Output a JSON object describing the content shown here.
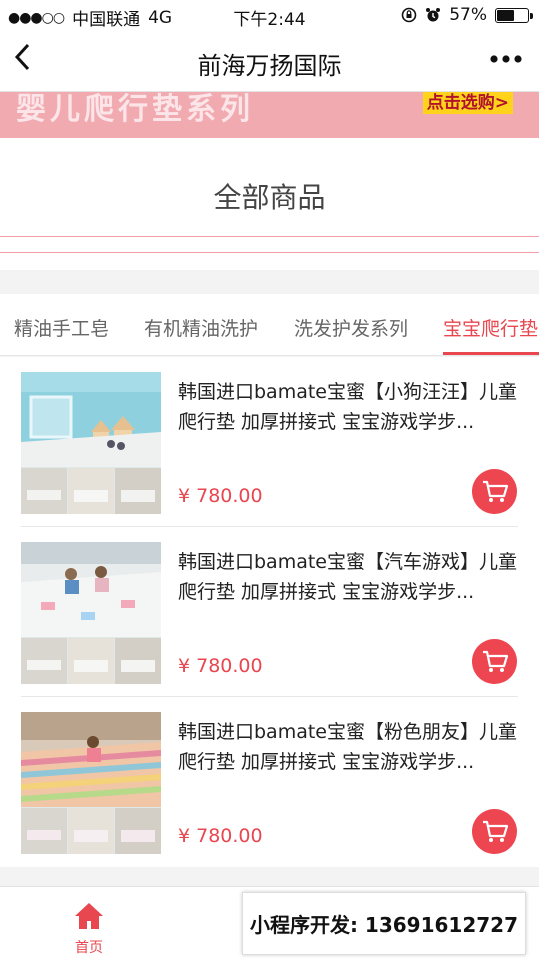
{
  "status_bar": {
    "signal": "●●●○○",
    "carrier": "中国联通",
    "network": "4G",
    "time": "下午2:44",
    "battery": "57%",
    "battery_level": 0.57
  },
  "nav": {
    "back_icon": "chevron-left-icon",
    "title": "前海万扬国际",
    "more_icon": "more-dots-icon"
  },
  "banner": {
    "text": "婴儿爬行垫系列",
    "button": "点击选购>"
  },
  "section": {
    "title": "全部商品"
  },
  "tabs": [
    {
      "label": "精油手工皂",
      "active": false
    },
    {
      "label": "有机精油洗护",
      "active": false
    },
    {
      "label": "洗发护发系列",
      "active": false
    },
    {
      "label": "宝宝爬行垫",
      "active": true
    }
  ],
  "products": [
    {
      "name": "韩国进口bamate宝蜜【小狗汪汪】儿童爬行垫 加厚拼接式 宝宝游戏学步...",
      "price": "¥ 780.00"
    },
    {
      "name": "韩国进口bamate宝蜜【汽车游戏】儿童爬行垫 加厚拼接式 宝宝游戏学步...",
      "price": "¥ 780.00"
    },
    {
      "name": "韩国进口bamate宝蜜【粉色朋友】儿童爬行垫 加厚拼接式 宝宝游戏学步...",
      "price": "¥ 780.00"
    }
  ],
  "tabbar": {
    "home_label": "首页"
  },
  "watermark": "小程序开发: 13691612727",
  "colors": {
    "accent": "#e8474f",
    "banner": "#f1aab0",
    "banner_button": "#ffd31c"
  }
}
